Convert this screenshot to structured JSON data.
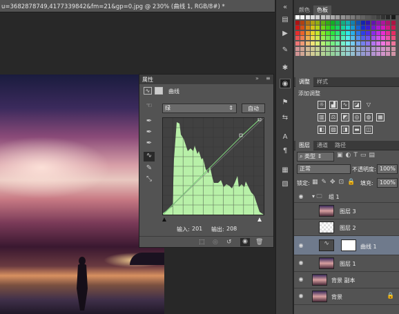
{
  "document": {
    "tab_title": "u=3682878749,4177339842&fm=21&gp=0.jpg @ 230% (曲线 1, RGB/8#) *"
  },
  "colors": {
    "accent_selected": "#6f7a8c",
    "curve": "#7cc87a",
    "histogram": "#b8f0a8"
  },
  "swatch_panel": {
    "tabs": [
      "颜色",
      "色板"
    ]
  },
  "adjust_panel": {
    "tabs": [
      "调整",
      "样式"
    ],
    "title": "添加调整",
    "icons": [
      "brightness-icon",
      "levels-icon",
      "curves-icon",
      "exposure-icon",
      "vibrance-icon",
      "hue-sat-icon",
      "color-balance-icon",
      "bw-icon",
      "photo-filter-icon",
      "channel-mixer-icon",
      "color-lookup-icon",
      "invert-icon",
      "posterize-icon",
      "threshold-icon",
      "gradient-map-icon",
      "selective-color-icon"
    ]
  },
  "layers_panel": {
    "tabs": [
      "图层",
      "通道",
      "路径"
    ],
    "kind_label": "类型",
    "blend_mode": "正常",
    "opacity_label": "不透明度:",
    "opacity_value": "100%",
    "lock_label": "锁定:",
    "fill_label": "填充:",
    "fill_value": "100%",
    "layers": [
      {
        "name": "组 1",
        "type": "group"
      },
      {
        "name": "图层 3",
        "type": "image"
      },
      {
        "name": "图层 2",
        "type": "image"
      },
      {
        "name": "曲线 1",
        "type": "adjustment"
      },
      {
        "name": "图层 1",
        "type": "image"
      },
      {
        "name": "背景 副本",
        "type": "image"
      },
      {
        "name": "背景",
        "type": "background"
      }
    ]
  },
  "properties_panel": {
    "title": "属性",
    "section_label": "曲线",
    "channel": "绿",
    "auto_button": "自动",
    "input_label": "输入:",
    "input_value": "201",
    "output_label": "输出:",
    "output_value": "208"
  }
}
